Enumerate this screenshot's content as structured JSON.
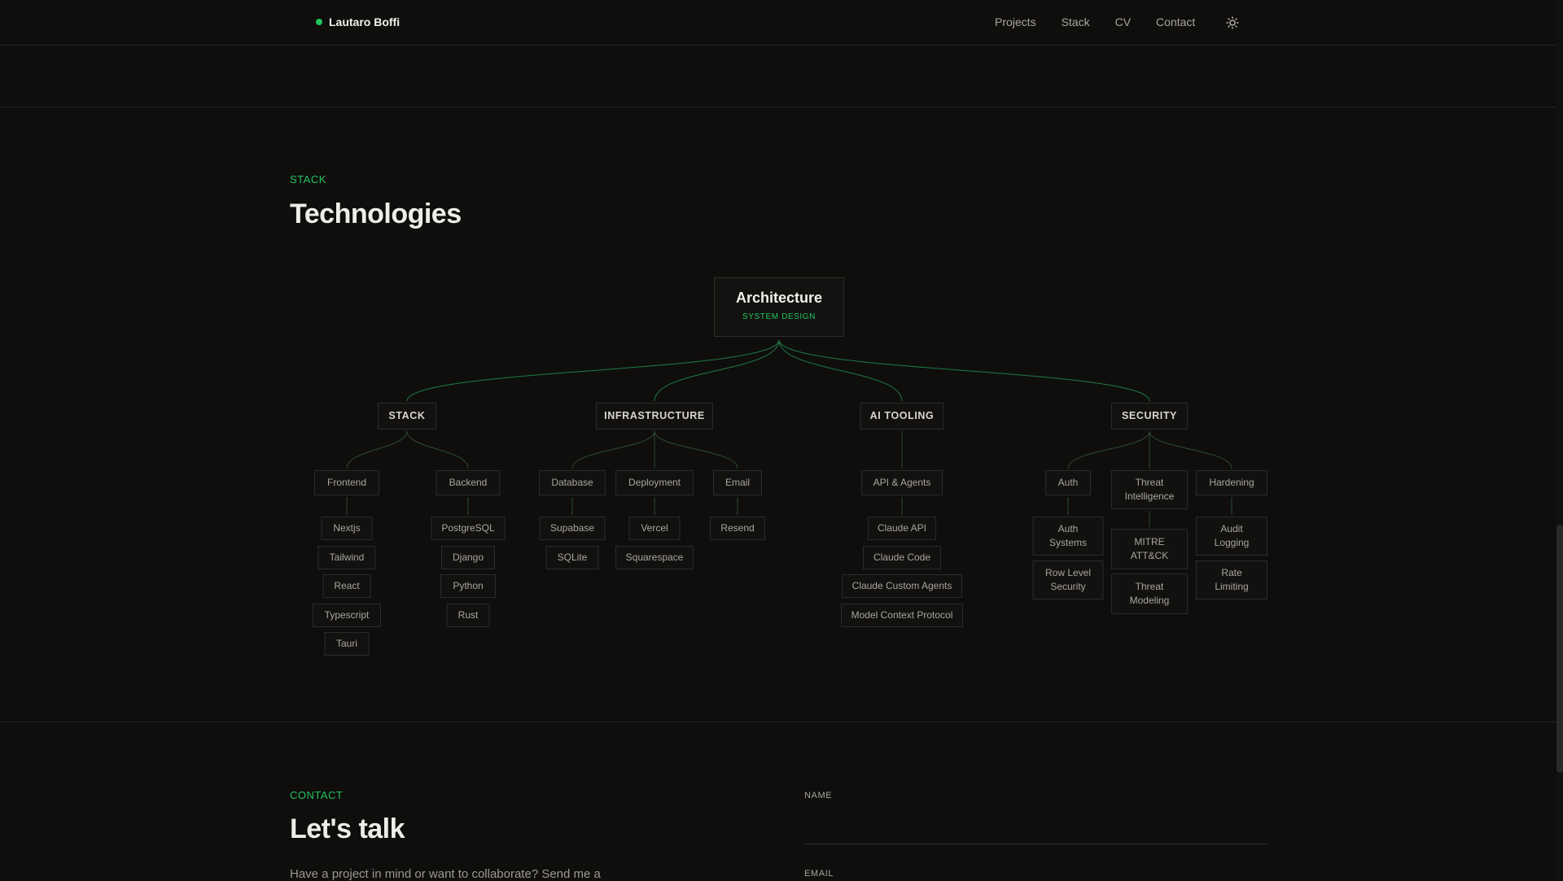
{
  "header": {
    "brand_name": "Lautaro Boffi",
    "nav": [
      "Projects",
      "Stack",
      "CV",
      "Contact"
    ],
    "theme_icon": "sun-icon"
  },
  "stack_section": {
    "eyebrow": "STACK",
    "title": "Technologies"
  },
  "tree": {
    "root": {
      "title": "Architecture",
      "subtitle": "SYSTEM DESIGN"
    },
    "categories": [
      {
        "label": "STACK",
        "groups": [
          {
            "label": "Frontend",
            "items": [
              "Nextjs",
              "Tailwind",
              "React",
              "Typescript",
              "Tauri"
            ]
          },
          {
            "label": "Backend",
            "items": [
              "PostgreSQL",
              "Django",
              "Python",
              "Rust"
            ]
          }
        ]
      },
      {
        "label": "INFRASTRUCTURE",
        "groups": [
          {
            "label": "Database",
            "items": [
              "Supabase",
              "SQLite"
            ]
          },
          {
            "label": "Deployment",
            "items": [
              "Vercel",
              "Squarespace"
            ]
          },
          {
            "label": "Email",
            "items": [
              "Resend"
            ]
          }
        ]
      },
      {
        "label": "AI TOOLING",
        "groups": [
          {
            "label": "API & Agents",
            "items": [
              "Claude API",
              "Claude Code",
              "Claude Custom Agents",
              "Model Context Protocol"
            ]
          }
        ]
      },
      {
        "label": "SECURITY",
        "groups": [
          {
            "label": "Auth",
            "items": [
              "Auth Systems",
              "Row Level Security"
            ]
          },
          {
            "label": "Threat Intelligence",
            "items": [
              "MITRE ATT&CK",
              "Threat Modeling"
            ]
          },
          {
            "label": "Hardening",
            "items": [
              "Audit Logging",
              "Rate Limiting"
            ]
          }
        ]
      }
    ]
  },
  "contact_section": {
    "eyebrow": "CONTACT",
    "title": "Let's talk",
    "text": "Have a project in mind or want to collaborate? Send me a",
    "name_label": "NAME",
    "email_label": "EMAIL"
  },
  "colors": {
    "accent": "#22c55e",
    "background": "#0f0e0d",
    "border": "#2c2b29"
  }
}
